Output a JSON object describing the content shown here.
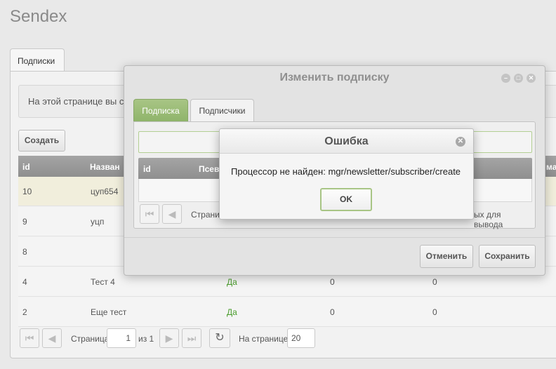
{
  "app": {
    "title": "Sendex"
  },
  "main_tabs": [
    {
      "label": "Подписки"
    }
  ],
  "info_text": "На этой странице вы с",
  "create_label": "Создать",
  "grid": {
    "columns": [
      "id",
      "Назван",
      "ма"
    ],
    "rows": [
      {
        "id": "10",
        "name": "цуп654",
        "active": "",
        "col3": "",
        "col4": "",
        "selected": true
      },
      {
        "id": "9",
        "name": "уцп",
        "active": "",
        "col3": "",
        "col4": ""
      },
      {
        "id": "8",
        "name": "",
        "active": "",
        "col3": "",
        "col4": ""
      },
      {
        "id": "4",
        "name": "Тест 4",
        "active": "Да",
        "col3": "0",
        "col4": "0"
      },
      {
        "id": "2",
        "name": "Еще тест",
        "active": "Да",
        "col3": "0",
        "col4": "0"
      }
    ]
  },
  "pager": {
    "page_label": "Страница",
    "page_value": "1",
    "of_label": "из 1",
    "per_page_label": "На странице:",
    "per_page_value": "20"
  },
  "edit_window": {
    "title": "Изменить подписку",
    "tabs": [
      {
        "label": "Подписка"
      },
      {
        "label": "Подписчики"
      }
    ],
    "grid_columns": [
      "id",
      "Псев"
    ],
    "pager_page_label": "Страниц",
    "pager_empty_text": "ых для вывода",
    "cancel_label": "Отменить",
    "save_label": "Сохранить"
  },
  "error_dialog": {
    "title": "Ошибка",
    "message": "Процессор не найден: mgr/newsletter/subscriber/create",
    "ok_label": "OK"
  },
  "icons": {
    "first": "first-page-icon",
    "prev": "prev-page-icon",
    "next": "next-page-icon",
    "last": "last-page-icon",
    "refresh": "refresh-icon",
    "close": "close-icon"
  },
  "colors": {
    "accent_green": "#8fb46a",
    "yes_green": "#4a9c2d",
    "grid_header": "#999999",
    "selected_row": "#f1eedc"
  }
}
